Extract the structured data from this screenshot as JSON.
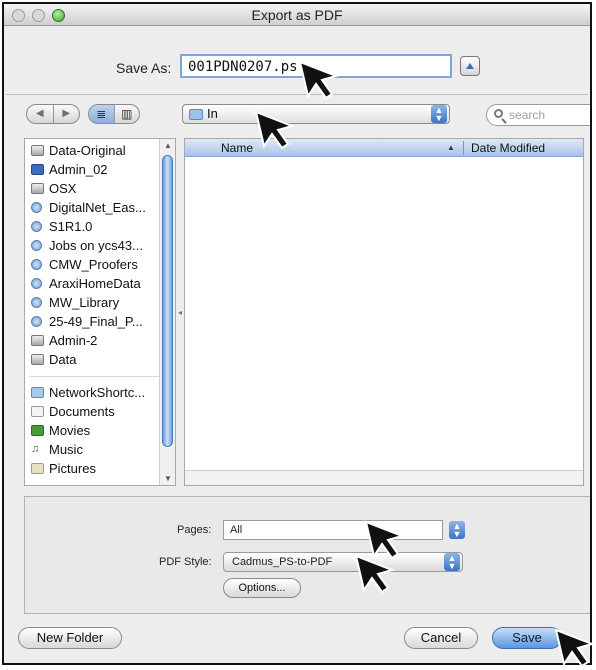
{
  "window": {
    "title": "Export as PDF"
  },
  "save_as": {
    "label": "Save As:",
    "value": "001PDN0207.ps"
  },
  "toolbar": {
    "back": "◀",
    "forward": "▶",
    "view_list": "≣",
    "view_columns": "▥",
    "location": "In",
    "search_placeholder": "search"
  },
  "sidebar": {
    "items": [
      {
        "label": "Data-Original",
        "icon": "disk-icon"
      },
      {
        "label": "Admin_02",
        "icon": "screen-icon"
      },
      {
        "label": "OSX",
        "icon": "disk-icon"
      },
      {
        "label": "DigitalNet_Eas...",
        "icon": "network-icon"
      },
      {
        "label": "S1R1.0",
        "icon": "network-icon"
      },
      {
        "label": "Jobs on ycs43...",
        "icon": "network-icon"
      },
      {
        "label": "CMW_Proofers",
        "icon": "network-icon"
      },
      {
        "label": "AraxiHomeData",
        "icon": "network-icon"
      },
      {
        "label": "MW_Library",
        "icon": "network-icon"
      },
      {
        "label": "25-49_Final_P...",
        "icon": "network-icon"
      },
      {
        "label": "Admin-2",
        "icon": "disk-icon"
      },
      {
        "label": "Data",
        "icon": "disk-icon"
      }
    ],
    "places": [
      {
        "label": "NetworkShortc...",
        "icon": "folder-icon"
      },
      {
        "label": "Documents",
        "icon": "document-icon"
      },
      {
        "label": "Movies",
        "icon": "movie-icon"
      },
      {
        "label": "Music",
        "icon": "music-icon"
      },
      {
        "label": "Pictures",
        "icon": "pictures-icon"
      }
    ]
  },
  "file_list": {
    "col_name": "Name",
    "col_date": "Date Modified",
    "sort_glyph": "▲"
  },
  "options": {
    "pages_label": "Pages:",
    "pages_value": "All",
    "pdf_style_label": "PDF Style:",
    "pdf_style_value": "Cadmus_PS-to-PDF",
    "options_button": "Options..."
  },
  "footer": {
    "new_folder": "New Folder",
    "cancel": "Cancel",
    "save": "Save"
  }
}
